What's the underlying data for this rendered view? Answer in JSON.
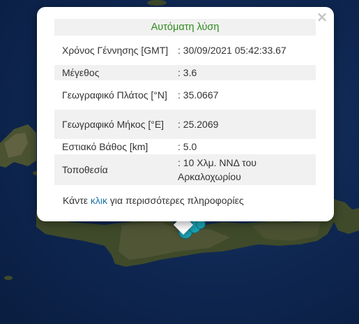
{
  "popup": {
    "title": "Αυτόματη λύση",
    "close_symbol": "×",
    "rows": [
      {
        "label": "Χρόνος Γέννησης [GMT]",
        "value": ": 30/09/2021 05:42:33.67"
      },
      {
        "label": "Μέγεθος",
        "value": ": 3.6"
      },
      {
        "label": "Γεωγραφικό Πλάτος [°N]",
        "value": ": 35.0667"
      },
      {
        "label": "Γεωγραφικό Μήκος [°E]",
        "value": ": 25.2069"
      },
      {
        "label": "Εστιακό Βάθος [km]",
        "value": ": 5.0"
      },
      {
        "label": "Τοποθεσία",
        "value": ": 10 Χλμ. ΝΝΔ του Αρκαλοχωρίου"
      }
    ],
    "footer_before": "Κάντε ",
    "footer_link": "κλικ",
    "footer_after": " για περισσότερες πληροφορίες"
  },
  "map": {
    "marker_color": "#1ba5b5",
    "sea_color": "#0e2650",
    "land_color": "#3d4a2a"
  }
}
